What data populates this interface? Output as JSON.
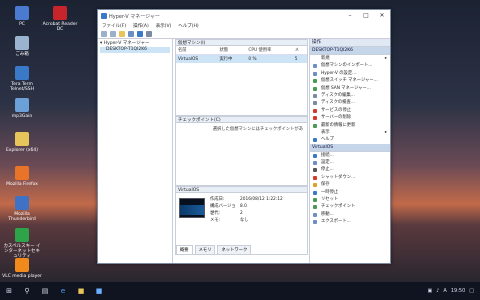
{
  "desktop_icons": [
    {
      "label": "PC",
      "color": "#4a7bd0"
    },
    {
      "label": "ごみ箱",
      "color": "#9ab3cf"
    },
    {
      "label": "Tera Term Telnet/SSH",
      "color": "#3a78c8"
    },
    {
      "label": "mp3Gain",
      "color": "#6ba0d8"
    },
    {
      "label": "Explorer (x64)",
      "color": "#e8c55a"
    },
    {
      "label": "Mozilla Firefox",
      "color": "#e8742a"
    },
    {
      "label": "Mozilla Thunderbird",
      "color": "#3f72c5"
    },
    {
      "label": "カスペルスキー インターネットセキュリティ",
      "color": "#2da34a"
    },
    {
      "label": "VLC media player",
      "color": "#f08a1c"
    },
    {
      "label": "Acrobat Reader DC",
      "color": "#c8242b"
    }
  ],
  "window": {
    "title": "Hyper-V マネージャー",
    "menu": [
      "ファイル(F)",
      "操作(A)",
      "表示(V)",
      "ヘルプ(H)"
    ]
  },
  "tree": {
    "root": "Hyper-V マネージャー",
    "host": "DESKTOP-T1QI2K6"
  },
  "vm_section": {
    "title": "仮想マシン(I)",
    "columns": [
      "名前",
      "状態",
      "CPU 使用率",
      "メ"
    ],
    "rows": [
      [
        "VirtualOS",
        "実行中",
        "0 %",
        "5"
      ]
    ]
  },
  "checkpoint_section": {
    "title": "チェックポイント(C)",
    "message": "選択した仮想マシンにはチェックポイントがあ"
  },
  "details": {
    "title": "VirtualOS",
    "fields": [
      {
        "label": "作成日:",
        "value": "2016/08/12 1:22:12"
      },
      {
        "label": "構成バージョン:",
        "value": "8.0"
      },
      {
        "label": "世代:",
        "value": "2"
      },
      {
        "label": "メモ:",
        "value": "なし"
      }
    ],
    "tabs": [
      "概要",
      "メモリ",
      "ネットワーク"
    ]
  },
  "actions": {
    "title": "操作",
    "host_header": "DESKTOP-T1QI2K6",
    "host_items": [
      {
        "label": "新規",
        "color": "#ffffff",
        "arrow": true
      },
      {
        "label": "仮想マシンのインポート...",
        "color": "#6b8fc4"
      },
      {
        "label": "Hyper-V の設定...",
        "color": "#6b8fc4"
      },
      {
        "label": "仮想スイッチ マネージャー...",
        "color": "#4b9a53"
      },
      {
        "label": "仮想 SAN マネージャー...",
        "color": "#4b9a53"
      },
      {
        "label": "ディスクの編集...",
        "color": "#7a8aa0"
      },
      {
        "label": "ディスクの検査...",
        "color": "#7a8aa0"
      },
      {
        "label": "サービスの停止",
        "color": "#d33a2c"
      },
      {
        "label": "サーバーの削除",
        "color": "#d33a2c"
      },
      {
        "label": "最新の情報に更新",
        "color": "#4b9a53"
      },
      {
        "label": "表示",
        "color": "#ffffff",
        "arrow": true
      },
      {
        "label": "ヘルプ",
        "color": "#3a78c8"
      }
    ],
    "vm_header": "VirtualOS",
    "vm_items": [
      {
        "label": "接続...",
        "color": "#3a78c8"
      },
      {
        "label": "設定...",
        "color": "#6b8fc4"
      },
      {
        "label": "停止...",
        "color": "#555555"
      },
      {
        "label": "シャットダウン...",
        "color": "#d33a2c"
      },
      {
        "label": "保存",
        "color": "#d9a227"
      },
      {
        "label": "一時停止",
        "color": "#3a78c8"
      },
      {
        "label": "リセット",
        "color": "#4b9a53"
      },
      {
        "label": "チェックポイント",
        "color": "#4b9a53"
      },
      {
        "label": "移動...",
        "color": "#6b8fc4"
      },
      {
        "label": "エクスポート...",
        "color": "#6b8fc4"
      }
    ]
  },
  "taskbar": {
    "time": "19:50"
  }
}
